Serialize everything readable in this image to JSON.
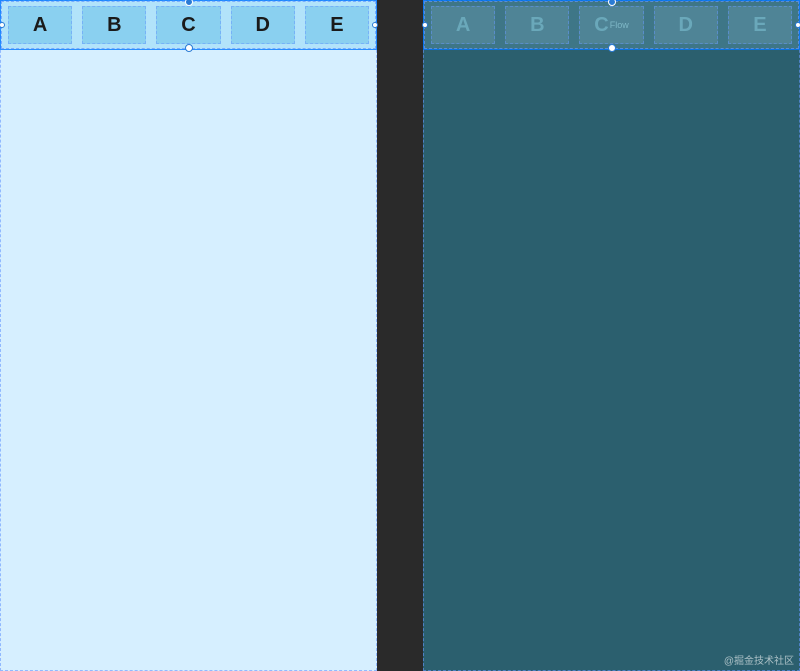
{
  "left": {
    "tabs": [
      "A",
      "B",
      "C",
      "D",
      "E"
    ]
  },
  "right": {
    "tabs": [
      "A",
      "B",
      "C",
      "D",
      "E"
    ],
    "badge": "Flow"
  },
  "watermark": "@掘金技术社区"
}
